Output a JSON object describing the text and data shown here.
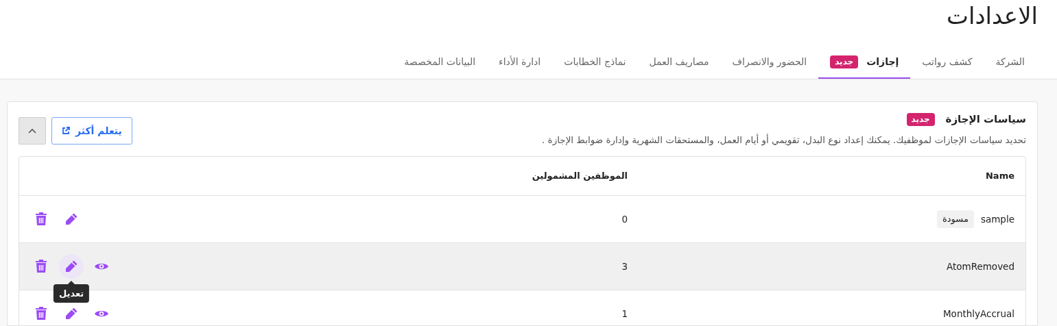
{
  "page_title": "الاعدادات",
  "tabs": [
    {
      "label": "الشركة",
      "selected": false
    },
    {
      "label": "كشف رواتب",
      "selected": false
    },
    {
      "label": "إجازات",
      "selected": true,
      "badge": "جديد"
    },
    {
      "label": "الحضور والانصراف",
      "selected": false
    },
    {
      "label": "مصاريف العمل",
      "selected": false
    },
    {
      "label": "نماذج الخطابات",
      "selected": false
    },
    {
      "label": "ادارة الأداء",
      "selected": false
    },
    {
      "label": "البيانات المخصصة",
      "selected": false
    }
  ],
  "section": {
    "title": "سياسات الإجازة",
    "badge": "جديد",
    "description": "تحديد سياسات الإجازات لموظفيك. يمكنك إعداد نوع البدل، تقويمي أو أيام العمل، والمستحقات الشهرية وإدارة ضوابط الإجازة .",
    "learn_more_button": "يتعلم أكثر",
    "expanded": true
  },
  "table": {
    "columns": [
      "Name",
      "الموظفين المشمولين"
    ],
    "rows": [
      {
        "name": "sample",
        "status": "مسودة",
        "employees": "0",
        "hovered": false,
        "actions": [
          {
            "kind": "edit"
          },
          {
            "kind": "delete"
          }
        ]
      },
      {
        "name": "AtomRemoved",
        "employees": "3",
        "hovered": true,
        "actions": [
          {
            "kind": "view"
          },
          {
            "kind": "edit"
          },
          {
            "kind": "delete"
          }
        ],
        "tooltip": "تعديل"
      },
      {
        "name": "MonthlyAccrual",
        "employees": "1",
        "hovered": false,
        "actions": [
          {
            "kind": "view"
          },
          {
            "kind": "edit"
          },
          {
            "kind": "delete"
          }
        ]
      }
    ]
  }
}
